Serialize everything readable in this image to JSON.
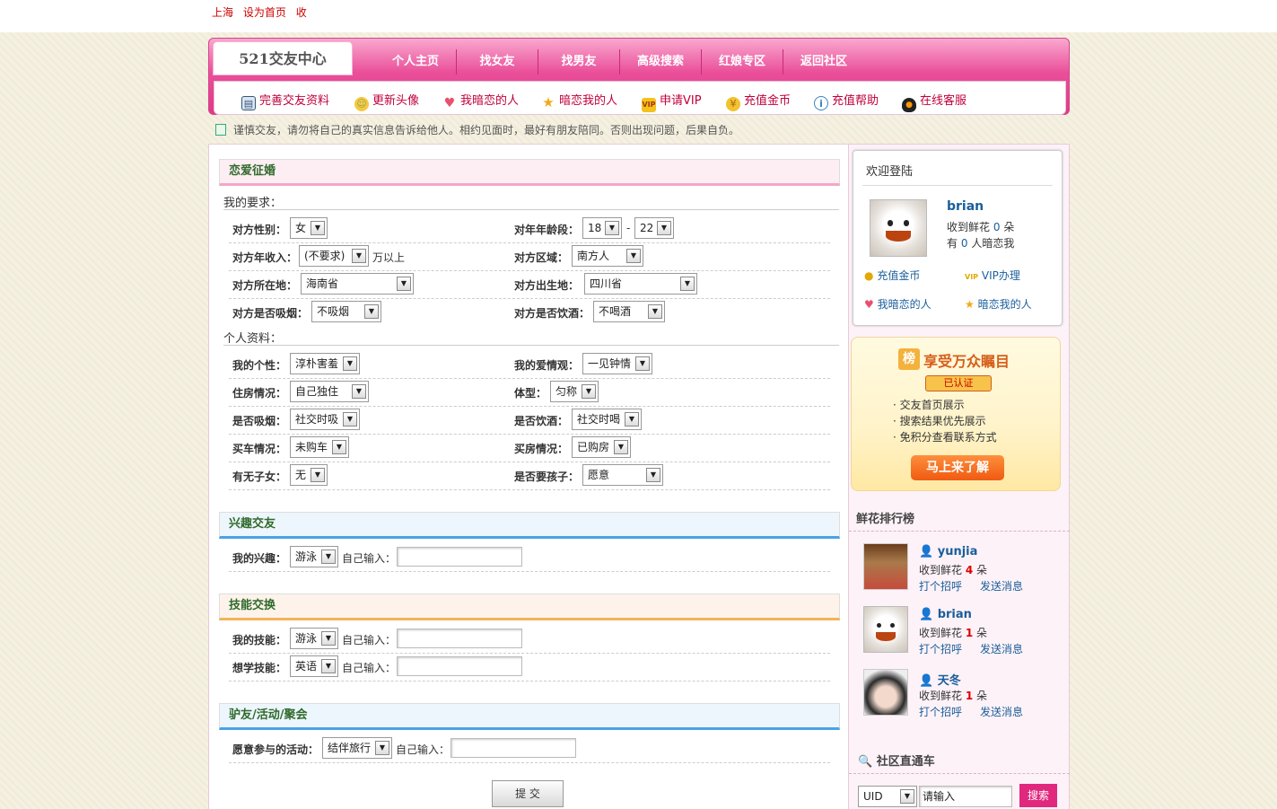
{
  "topbar": {
    "links": [
      "上海",
      "设为首页",
      "收"
    ]
  },
  "nav": {
    "logo": "521交友中心",
    "items": [
      "个人主页",
      "找女友",
      "找男友",
      "高级搜索",
      "红娘专区",
      "返回社区"
    ]
  },
  "subnav": {
    "items": [
      {
        "label": "完善交友资料",
        "icon": "profile-card-icon"
      },
      {
        "label": "更新头像",
        "icon": "smiley-icon"
      },
      {
        "label": "我暗恋的人",
        "icon": "heart-icon"
      },
      {
        "label": "暗恋我的人",
        "icon": "star-icon"
      },
      {
        "label": "申请VIP",
        "icon": "vip-crown-icon"
      },
      {
        "label": "充值金币",
        "icon": "coins-icon"
      },
      {
        "label": "充值帮助",
        "icon": "info-icon"
      },
      {
        "label": "在线客服",
        "icon": "penguin-icon"
      }
    ]
  },
  "notice": "谨慎交友，请勿将自己的真实信息告诉给他人。相约见面时，最好有朋友陪同。否则出现问题，后果自负。",
  "sections": {
    "love": {
      "title": "恋爱征婚",
      "req_title": "我的要求：",
      "req": {
        "gender_label": "对方性别：",
        "gender": "女",
        "age_label": "对年年龄段：",
        "age_from": "18",
        "age_sep": "-",
        "age_to": "22",
        "income_label": "对方年收入：",
        "income": "(不要求)",
        "income_suffix": "万以上",
        "region_label": "对方区域：",
        "region": "南方人",
        "location_label": "对方所在地：",
        "location": "海南省",
        "birth_label": "对方出生地：",
        "birth": "四川省",
        "smoke_label": "对方是否吸烟：",
        "smoke": "不吸烟",
        "drink_label": "对方是否饮酒：",
        "drink": "不喝酒"
      },
      "info_title": "个人资料：",
      "info": {
        "personality_label": "我的个性：",
        "personality": "淳朴害羞",
        "loveview_label": "我的爱情观：",
        "loveview": "一见钟情",
        "housing_label": "住房情况：",
        "housing": "自己独住",
        "body_label": "体型：",
        "body": "匀称",
        "smoke_label": "是否吸烟：",
        "smoke": "社交时吸",
        "drink_label": "是否饮酒：",
        "drink": "社交时喝",
        "car_label": "买车情况：",
        "car": "未购车",
        "house_label": "买房情况：",
        "house": "已购房",
        "kids_label": "有无子女：",
        "kids": "无",
        "wantkids_label": "是否要孩子：",
        "wantkids": "愿意"
      }
    },
    "interest": {
      "title": "兴趣交友",
      "label": "我的兴趣：",
      "value": "游泳",
      "input_label": "自己输入："
    },
    "skill": {
      "title": "技能交换",
      "my_label": "我的技能：",
      "my_value": "游泳",
      "want_label": "想学技能：",
      "want_value": "英语",
      "input_label": "自己输入："
    },
    "activity": {
      "title": "驴友/活动/聚会",
      "label": "愿意参与的活动：",
      "value": "结伴旅行",
      "input_label": "自己输入："
    }
  },
  "submit_label": "提 交",
  "sidebar": {
    "welcome_title": "欢迎登陆",
    "user": {
      "name": "brian",
      "flowers_prefix": "收到鲜花",
      "flowers": "0",
      "flowers_unit": "朵",
      "crush_prefix": "有",
      "crush": "0",
      "crush_suffix": "人暗恋我"
    },
    "links": [
      "充值金币",
      "VIP办理",
      "我暗恋的人",
      "暗恋我的人"
    ],
    "promo": {
      "badge": "榜",
      "title": "享受万众瞩目",
      "vip_tag": "已认证",
      "bullets": [
        "· 交友首页展示",
        "· 搜索结果优先展示",
        "· 免积分查看联系方式"
      ],
      "button": "马上来了解"
    },
    "rank_title": "鲜花排行榜",
    "rank": [
      {
        "name": "yunjia",
        "prefix": "收到鲜花",
        "count": "4",
        "unit": "朵",
        "greet": "打个招呼",
        "msg": "发送消息"
      },
      {
        "name": "brian",
        "prefix": "收到鲜花",
        "count": "1",
        "unit": "朵",
        "greet": "打个招呼",
        "msg": "发送消息"
      },
      {
        "name": "天冬",
        "prefix": "收到鲜花",
        "count": "1",
        "unit": "朵",
        "greet": "打个招呼",
        "msg": "发送消息"
      }
    ],
    "search_title": "社区直通车",
    "search_type": "UID",
    "search_value": "请输入",
    "search_button": "搜索"
  },
  "colors": {
    "brand_pink": "#e03888",
    "link_blue": "#1a5e9b",
    "section_green": "#2f6a2b"
  }
}
